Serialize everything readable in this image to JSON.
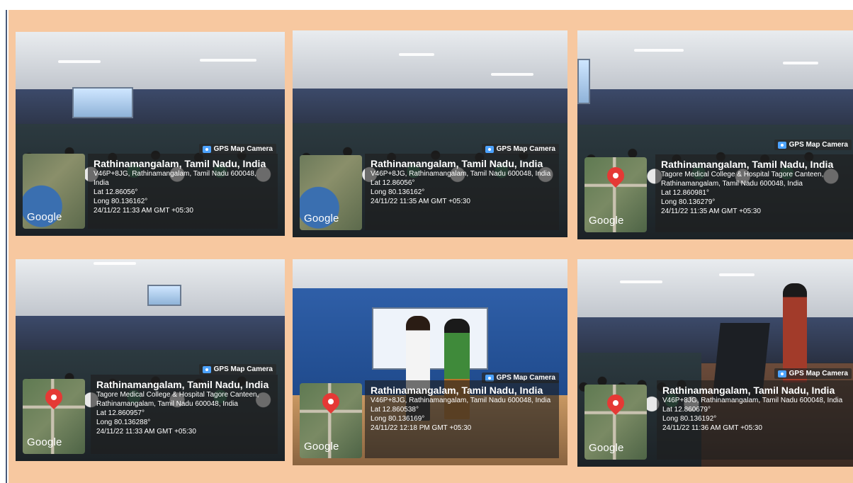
{
  "photos": [
    {
      "tag": "GPS Map Camera",
      "logo": "Google",
      "title": "Rathinamangalam, Tamil Nadu, India",
      "addr": "V46P+8JG, Rathinamangalam, Tamil Nadu 600048, India",
      "lat": "Lat 12.86056°",
      "long": "Long 80.136162°",
      "time": "24/11/22 11:33 AM GMT +05:30"
    },
    {
      "tag": "GPS Map Camera",
      "logo": "Google",
      "title": "Rathinamangalam, Tamil Nadu, India",
      "addr": "V46P+8JG, Rathinamangalam, Tamil Nadu 600048, India",
      "lat": "Lat 12.86056°",
      "long": "Long 80.136162°",
      "time": "24/11/22 11:35 AM GMT +05:30"
    },
    {
      "tag": "GPS Map Camera",
      "logo": "Google",
      "title": "Rathinamangalam, Tamil Nadu, India",
      "addr": "Tagore Medical College & Hospital Tagore Canteen, Rathinamangalam, Tamil Nadu 600048, India",
      "lat": "Lat 12.860981°",
      "long": "Long 80.136279°",
      "time": "24/11/22 11:35 AM GMT +05:30"
    },
    {
      "tag": "GPS Map Camera",
      "logo": "Google",
      "title": "Rathinamangalam, Tamil Nadu, India",
      "addr": "Tagore Medical College & Hospital Tagore Canteen, Rathinamangalam, Tamil Nadu 600048, India",
      "lat": "Lat 12.860957°",
      "long": "Long 80.136288°",
      "time": "24/11/22 11:33 AM GMT +05:30"
    },
    {
      "tag": "GPS Map Camera",
      "logo": "Google",
      "title": "Rathinamangalam, Tamil Nadu, India",
      "addr": "V46P+8JG, Rathinamangalam, Tamil Nadu 600048, India",
      "lat": "Lat 12.860538°",
      "long": "Long 80.136169°",
      "time": "24/11/22 12:18 PM GMT +05:30"
    },
    {
      "tag": "GPS Map Camera",
      "logo": "Google",
      "title": "Rathinamangalam, Tamil Nadu, India",
      "addr": "V46P+8JG, Rathinamangalam, Tamil Nadu 600048, India",
      "lat": "Lat 12.860679°",
      "long": "Long 80.136192°",
      "time": "24/11/22 11:36 AM GMT +05:30"
    }
  ]
}
